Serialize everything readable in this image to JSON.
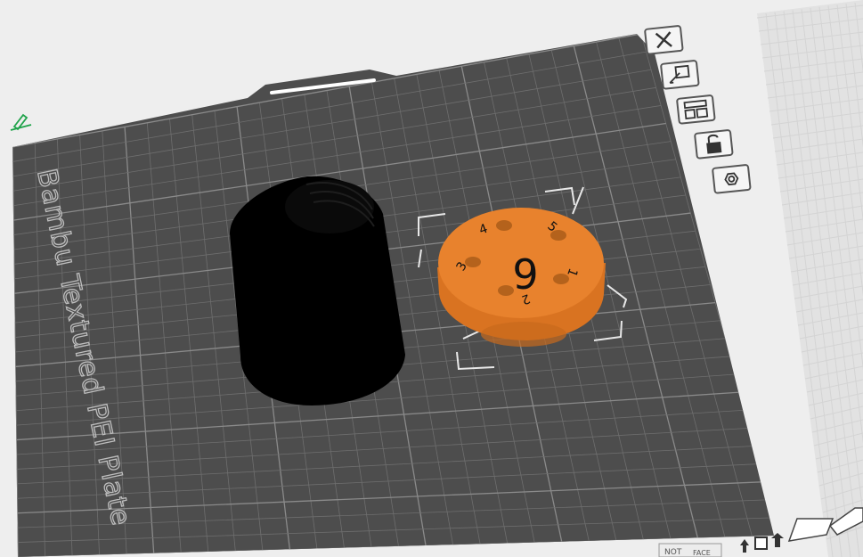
{
  "plate": {
    "name_label": "Bambu Textured PEI Plate"
  },
  "objects": {
    "dial": {
      "center_label": "6",
      "hole_labels": [
        "1",
        "2",
        "3",
        "4",
        "5"
      ],
      "color": "#e8822d"
    },
    "cylinder": {
      "color": "#000000"
    }
  },
  "toolbar": {
    "items": [
      {
        "icon": "close-icon"
      },
      {
        "icon": "edit-plate-icon"
      },
      {
        "icon": "arrange-icon"
      },
      {
        "icon": "lock-icon"
      },
      {
        "icon": "settings-hex-icon"
      }
    ]
  },
  "bottom_bar": {
    "left_text": "NOT",
    "right_text": "FACE"
  },
  "colors": {
    "plate": "#4d4d4d",
    "grid": "#727272",
    "background": "#eeeeee",
    "accent_green": "#1fa34a"
  }
}
